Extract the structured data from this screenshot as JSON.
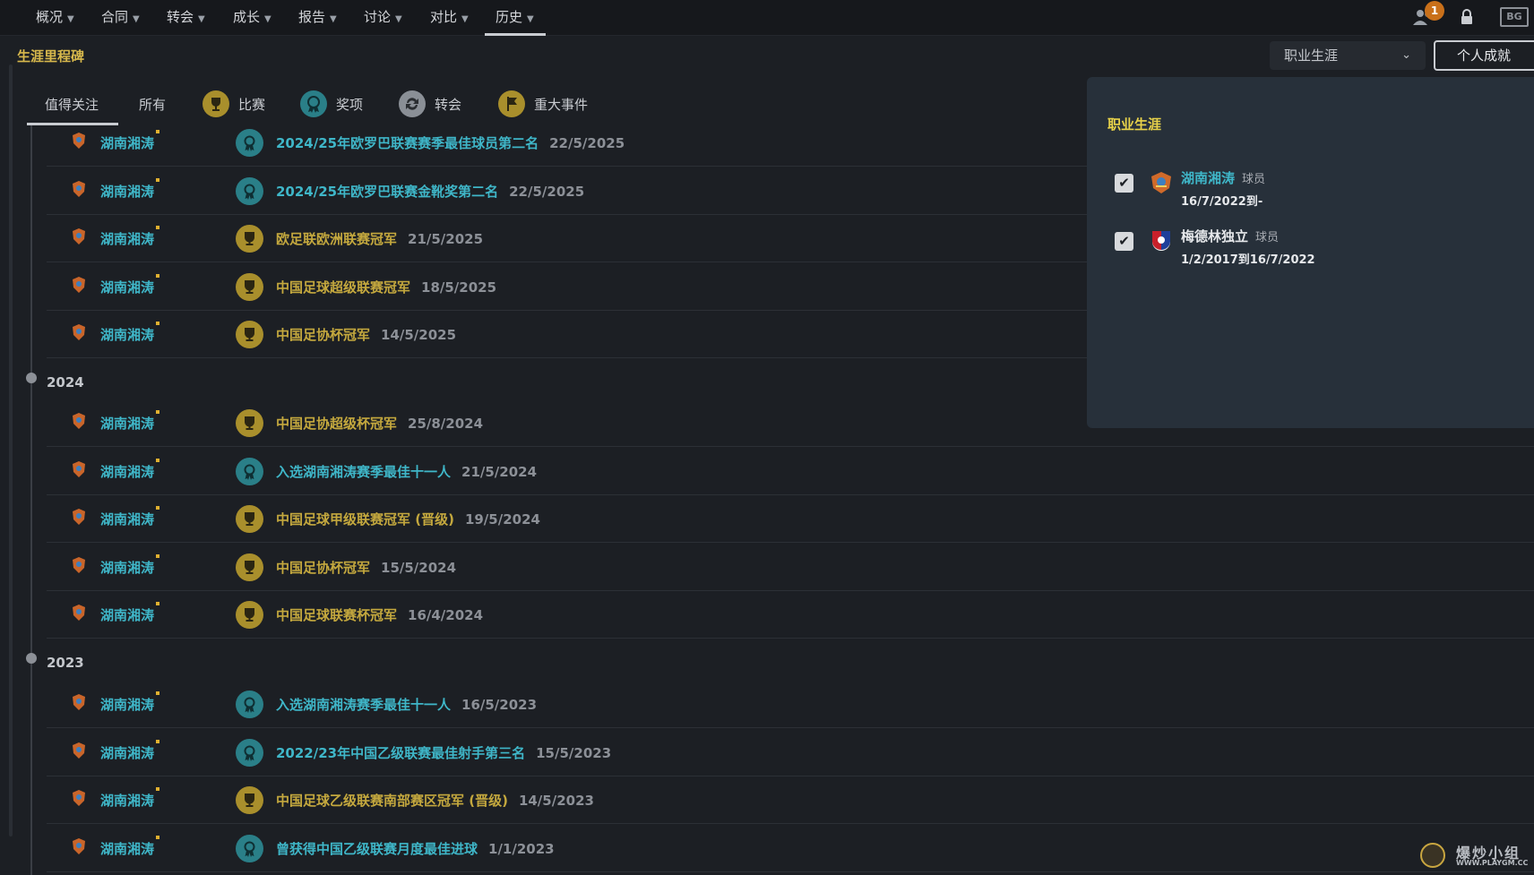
{
  "nav": [
    {
      "label": "概况"
    },
    {
      "label": "合同"
    },
    {
      "label": "转会"
    },
    {
      "label": "成长"
    },
    {
      "label": "报告"
    },
    {
      "label": "讨论"
    },
    {
      "label": "对比"
    },
    {
      "label": "历史"
    }
  ],
  "notifications": {
    "count": "1"
  },
  "header": {
    "title": "生涯里程碑",
    "career_select": "职业生涯",
    "achievements_button": "个人成就"
  },
  "tabs": [
    {
      "label": "值得关注",
      "icon": ""
    },
    {
      "label": "所有",
      "icon": ""
    },
    {
      "label": "比赛",
      "icon": "trophy-icon"
    },
    {
      "label": "奖项",
      "icon": "medal-icon"
    },
    {
      "label": "转会",
      "icon": "transfer-icon"
    },
    {
      "label": "重大事件",
      "icon": "flag-icon"
    }
  ],
  "milestones": {
    "group0": [
      {
        "club": "湖南湘涛",
        "type": "award",
        "text": "2024/25年欧罗巴联赛赛季最佳球员第二名",
        "date": "22/5/2025"
      },
      {
        "club": "湖南湘涛",
        "type": "award",
        "text": "2024/25年欧罗巴联赛金靴奖第二名",
        "date": "22/5/2025"
      },
      {
        "club": "湖南湘涛",
        "type": "trophy",
        "text": "欧足联欧洲联赛冠军",
        "date": "21/5/2025"
      },
      {
        "club": "湖南湘涛",
        "type": "trophy",
        "text": "中国足球超级联赛冠军",
        "date": "18/5/2025"
      },
      {
        "club": "湖南湘涛",
        "type": "trophy",
        "text": "中国足协杯冠军",
        "date": "14/5/2025"
      }
    ],
    "year2024": "2024",
    "group2024": [
      {
        "club": "湖南湘涛",
        "type": "trophy",
        "text": "中国足协超级杯冠军",
        "date": "25/8/2024"
      },
      {
        "club": "湖南湘涛",
        "type": "award",
        "text": "入选湖南湘涛赛季最佳十一人",
        "date": "21/5/2024"
      },
      {
        "club": "湖南湘涛",
        "type": "trophy",
        "text": "中国足球甲级联赛冠军 (晋级)",
        "date": "19/5/2024"
      },
      {
        "club": "湖南湘涛",
        "type": "trophy",
        "text": "中国足协杯冠军",
        "date": "15/5/2024"
      },
      {
        "club": "湖南湘涛",
        "type": "trophy",
        "text": "中国足球联赛杯冠军",
        "date": "16/4/2024"
      }
    ],
    "year2023": "2023",
    "group2023": [
      {
        "club": "湖南湘涛",
        "type": "award",
        "text": "入选湖南湘涛赛季最佳十一人",
        "date": "16/5/2023"
      },
      {
        "club": "湖南湘涛",
        "type": "award",
        "text": "2022/23年中国乙级联赛最佳射手第三名",
        "date": "15/5/2023"
      },
      {
        "club": "湖南湘涛",
        "type": "trophy",
        "text": "中国足球乙级联赛南部赛区冠军 (晋级)",
        "date": "14/5/2023"
      },
      {
        "club": "湖南湘涛",
        "type": "award",
        "text": "曾获得中国乙级联赛月度最佳进球",
        "date": "1/1/2023"
      }
    ]
  },
  "popup": {
    "title": "职业生涯",
    "entries": [
      {
        "club": "湖南湘涛",
        "role": "球员",
        "dates": "16/7/2022到-",
        "checked": "✔"
      },
      {
        "club": "梅德林独立",
        "role": "球员",
        "dates": "1/2/2017到16/7/2022",
        "checked": "✔"
      }
    ]
  },
  "watermark": {
    "main": "爆炒小组",
    "sub": "WWW.PLAYGM.CC"
  }
}
